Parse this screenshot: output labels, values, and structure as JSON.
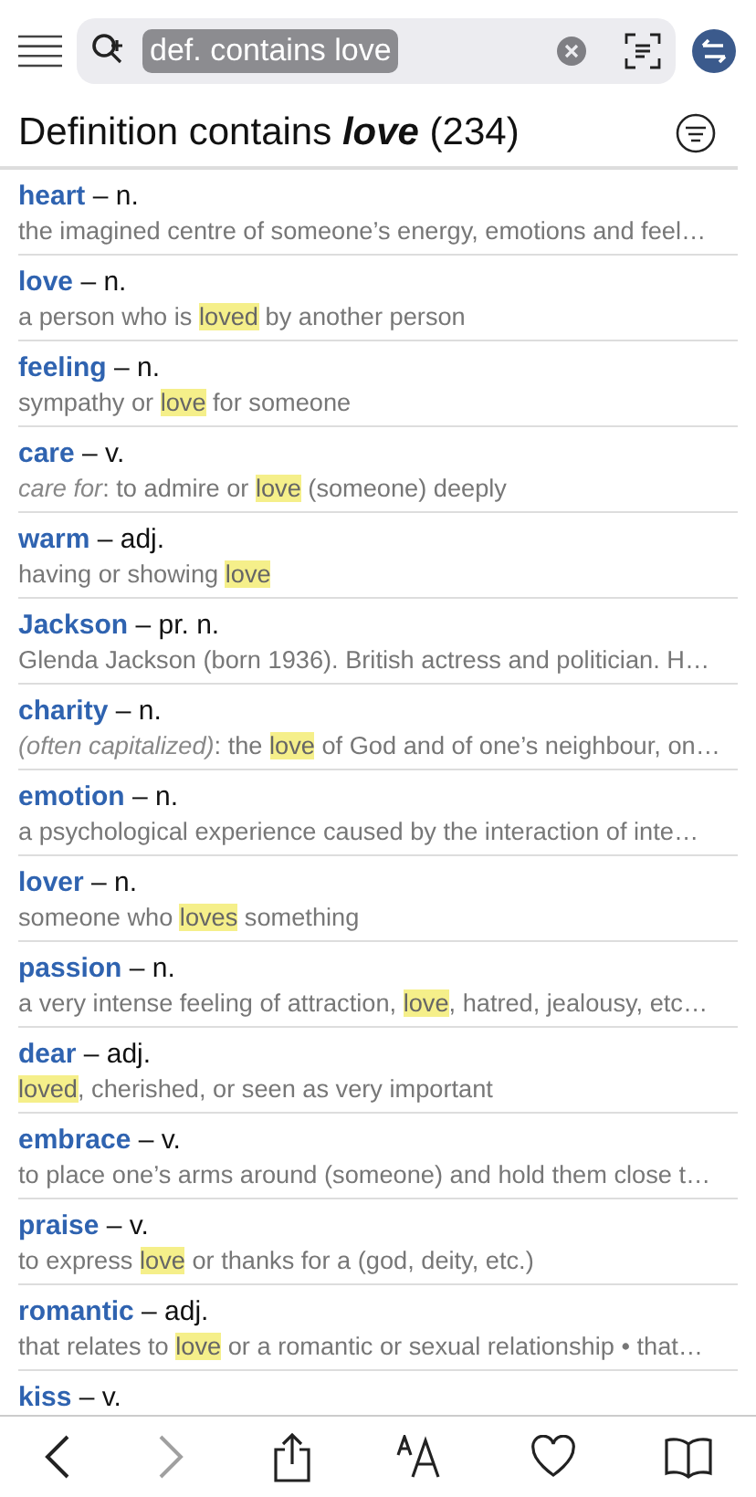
{
  "search": {
    "token": "def. contains love"
  },
  "heading": "Definition contains **love** (234)",
  "results": [
    {
      "word": "heart",
      "pos": "– n.",
      "definition": [
        {
          "kind": "plain",
          "text": "the imagined centre of someone’s energy, emotions and feel…"
        }
      ]
    },
    {
      "word": "love",
      "pos": "– n.",
      "definition": [
        {
          "kind": "plain",
          "text": "a person who is "
        },
        {
          "kind": "match",
          "text": "loved"
        },
        {
          "kind": "plain",
          "text": " by another person"
        }
      ]
    },
    {
      "word": "feeling",
      "pos": "– n.",
      "definition": [
        {
          "kind": "plain",
          "text": "sympathy or "
        },
        {
          "kind": "match",
          "text": "love"
        },
        {
          "kind": "plain",
          "text": " for someone"
        }
      ]
    },
    {
      "word": "care",
      "pos": "– v.",
      "definition": [
        {
          "kind": "label",
          "text": "care for"
        },
        {
          "kind": "plain",
          "text": ": to admire or "
        },
        {
          "kind": "match",
          "text": "love"
        },
        {
          "kind": "plain",
          "text": " (someone) deeply"
        }
      ]
    },
    {
      "word": "warm",
      "pos": "– adj.",
      "definition": [
        {
          "kind": "plain",
          "text": "having or showing "
        },
        {
          "kind": "match",
          "text": "love"
        }
      ]
    },
    {
      "word": "Jackson",
      "pos": "– pr. n.",
      "definition": [
        {
          "kind": "plain",
          "text": "Glenda Jackson (born 1936). British actress and politician. H…"
        }
      ]
    },
    {
      "word": "charity",
      "pos": "– n.",
      "definition": [
        {
          "kind": "label",
          "text": "(often capitalized)"
        },
        {
          "kind": "plain",
          "text": ": the "
        },
        {
          "kind": "match",
          "text": "love"
        },
        {
          "kind": "plain",
          "text": " of God and of one’s neighbour, on…"
        }
      ]
    },
    {
      "word": "emotion",
      "pos": "– n.",
      "definition": [
        {
          "kind": "plain",
          "text": "a psychological experience caused by the interaction of inte…"
        }
      ]
    },
    {
      "word": "lover",
      "pos": "– n.",
      "definition": [
        {
          "kind": "plain",
          "text": "someone who "
        },
        {
          "kind": "match",
          "text": "loves"
        },
        {
          "kind": "plain",
          "text": " something"
        }
      ]
    },
    {
      "word": "passion",
      "pos": "– n.",
      "definition": [
        {
          "kind": "plain",
          "text": "a very intense feeling of attraction, "
        },
        {
          "kind": "match",
          "text": "love"
        },
        {
          "kind": "plain",
          "text": ", hatred, jealousy, etc…"
        }
      ]
    },
    {
      "word": "dear",
      "pos": "– adj.",
      "definition": [
        {
          "kind": "match",
          "text": "loved"
        },
        {
          "kind": "plain",
          "text": ", cherished, or seen as very important"
        }
      ]
    },
    {
      "word": "embrace",
      "pos": "– v.",
      "definition": [
        {
          "kind": "plain",
          "text": "to place one’s arms around (someone) and hold them close t…"
        }
      ]
    },
    {
      "word": "praise",
      "pos": "– v.",
      "definition": [
        {
          "kind": "plain",
          "text": "to express "
        },
        {
          "kind": "match",
          "text": "love"
        },
        {
          "kind": "plain",
          "text": " or thanks for a (god, deity, etc.)"
        }
      ]
    },
    {
      "word": "romantic",
      "pos": "– adj.",
      "definition": [
        {
          "kind": "plain",
          "text": "that relates to "
        },
        {
          "kind": "match",
          "text": "love"
        },
        {
          "kind": "plain",
          "text": " or a romantic or sexual relationship • that…"
        }
      ]
    },
    {
      "word": "kiss",
      "pos": "– v."
    }
  ],
  "toolbar": [
    {
      "kind": "back",
      "disabled": false
    },
    {
      "kind": "forward",
      "disabled": true
    },
    {
      "kind": "share",
      "disabled": false
    },
    {
      "kind": "font",
      "disabled": false
    },
    {
      "kind": "favorite",
      "disabled": false
    },
    {
      "kind": "book",
      "disabled": false
    }
  ]
}
